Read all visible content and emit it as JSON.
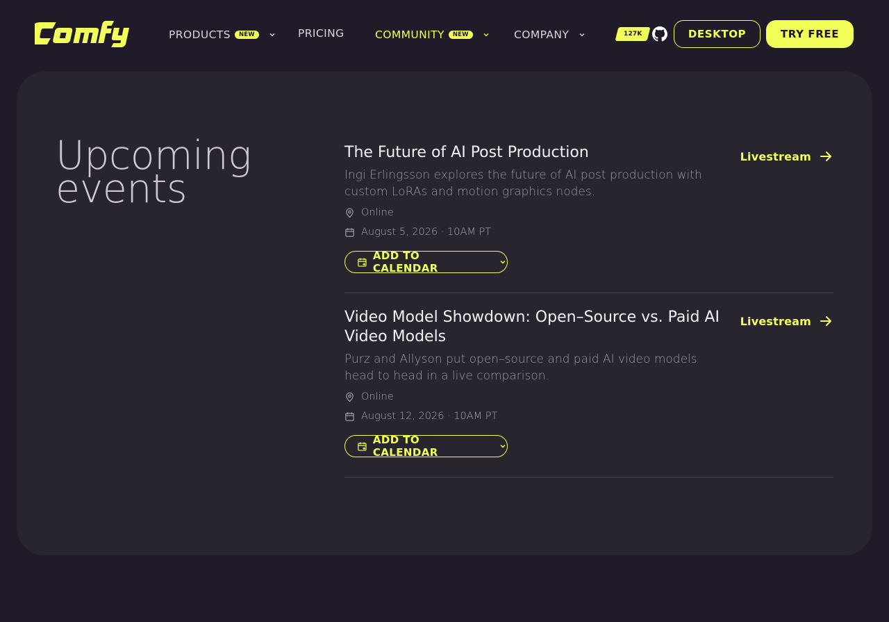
{
  "brand": {
    "logo_text": "Comfy",
    "accent_color": "#f2ff59",
    "bg_color": "#211a28"
  },
  "nav": {
    "items": [
      {
        "label": "PRODUCTS",
        "badge": "NEW",
        "has_dropdown": true
      },
      {
        "label": "PRICING",
        "badge": "",
        "has_dropdown": false
      },
      {
        "label": "COMMUNITY",
        "badge": "NEW",
        "has_dropdown": true,
        "active": true
      },
      {
        "label": "COMPANY",
        "badge": "",
        "has_dropdown": true
      }
    ],
    "github_stars": "127K",
    "github_icon": "github-icon",
    "desktop_label": "DESKTOP",
    "try_free_label": "TRY FREE"
  },
  "section": {
    "heading": "Upcoming events"
  },
  "events": [
    {
      "title": "The Future of AI Post Production",
      "description": "Ingi Erlingsson explores the future of AI post production with custom LoRAs and motion graphics nodes.",
      "location": "Online",
      "datetime": "August 5, 2026 · 10AM PT",
      "calendar_label": "ADD TO CALENDAR",
      "link_label": "Livestream"
    },
    {
      "title": "Video Model Showdown: Open–Source vs. Paid AI Video Models",
      "description": "Purz and Allyson put open–source and paid AI video models head to head in a live comparison.",
      "location": "Online",
      "datetime": "August 12, 2026 · 10AM PT",
      "calendar_label": "ADD TO CALENDAR",
      "link_label": "Livestream"
    }
  ]
}
